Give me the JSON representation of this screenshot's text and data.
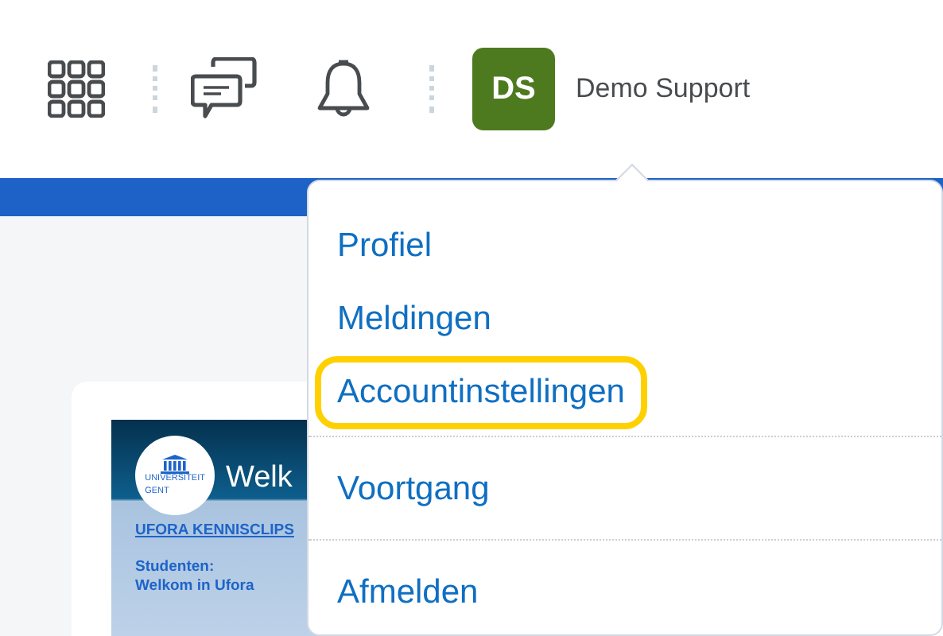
{
  "header": {
    "user": {
      "initials": "DS",
      "name": "Demo Support"
    }
  },
  "course_card": {
    "thumbnail": {
      "logo_text": "UNIVERSITEIT GENT",
      "title": "Welk",
      "series": "UFORA KENNISCLIPS",
      "subtitle": "Studenten:",
      "caption": "Welkom in Ufora"
    }
  },
  "account_menu": {
    "groups": [
      [
        {
          "label": "Profiel",
          "focused": false
        },
        {
          "label": "Meldingen",
          "focused": false
        },
        {
          "label": "Accountinstellingen",
          "focused": true
        }
      ],
      [
        {
          "label": "Voortgang",
          "focused": false
        }
      ],
      [
        {
          "label": "Afmelden",
          "focused": false
        }
      ]
    ]
  }
}
